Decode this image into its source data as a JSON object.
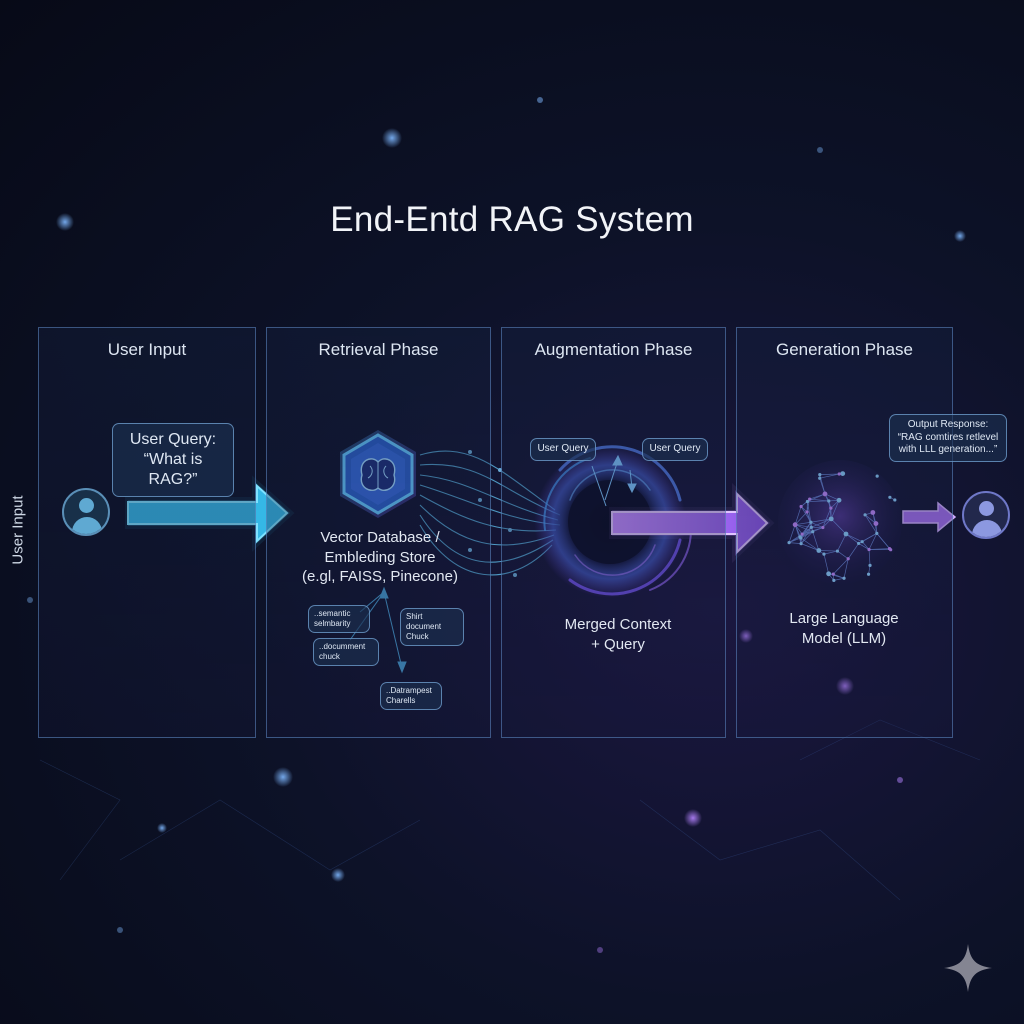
{
  "title": "End-Entd RAG System",
  "side_label": "User Input",
  "phases": [
    {
      "name": "User Input"
    },
    {
      "name": "Retrieval Phase"
    },
    {
      "name": "Augmentation Phase"
    },
    {
      "name": "Generation Phase"
    }
  ],
  "user_query_bubble": {
    "line1": "User Query:",
    "line2": "“What is RAG?”"
  },
  "vector_db_caption": {
    "line1": "Vector Database /",
    "line2": "Embleding Store",
    "line3": "(e.gl, FAISS, Pinecone)"
  },
  "retrieval_chunks": [
    {
      "line1": "..semantic",
      "line2": "selmbarity"
    },
    {
      "line1": "..documment",
      "line2": "chuck"
    },
    {
      "line1": "Shirt document",
      "line2": "Chuck"
    },
    {
      "line1": "..Datrampest",
      "line2": "Charells"
    }
  ],
  "augmentation_bubbles": [
    {
      "text": "User Query"
    },
    {
      "text": "User Query"
    }
  ],
  "merged_caption": {
    "line1": "Merged Context",
    "line2": "+ Query"
  },
  "output_bubble": {
    "line1": "Output Response:",
    "line2": "“RAG comtires retlevel",
    "line3": "with LLL generation...”"
  },
  "llm_caption": {
    "line1": "Large Language",
    "line2": "Model (LLM)"
  },
  "icons": [
    "user-avatar-icon",
    "brain-hexagon-icon",
    "swirl-vortex-icon",
    "neural-sphere-icon",
    "sparkle-icon"
  ],
  "colors": {
    "cyan": "#38c6ee",
    "purple": "#a16bf0",
    "panel_border": "#608cc8"
  }
}
